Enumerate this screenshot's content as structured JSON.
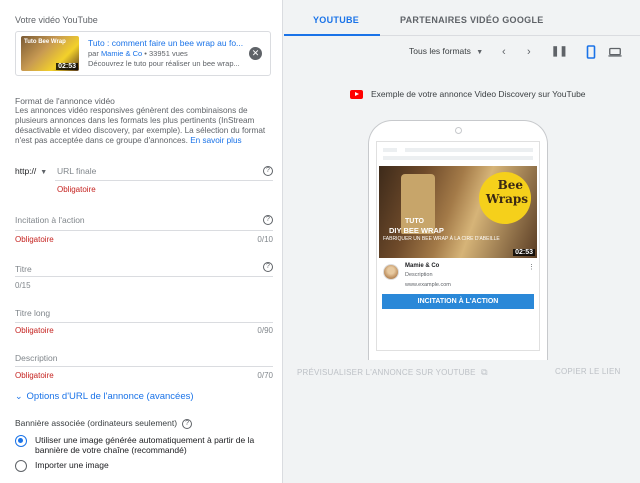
{
  "left": {
    "video_section_label": "Votre vidéo YouTube",
    "video": {
      "thumb_text": "Tuto Bee Wrap",
      "duration": "02:53",
      "title": "Tuto : comment faire un bee wrap au fo...",
      "by": "par",
      "channel": "Mamie & Co",
      "views": "• 33951 vues",
      "description": "Découvrez le tuto pour réaliser un bee wrap..."
    },
    "format": {
      "title": "Format de l'annonce vidéo",
      "text": "Les annonces vidéo responsives génèrent des combinaisons de plusieurs annonces dans les formats les plus pertinents (InStream désactivable et video discovery, par exemple). La sélection du format n'est pas acceptée dans ce groupe d'annonces.",
      "link": "En savoir plus"
    },
    "url_field": {
      "protocol": "http://",
      "placeholder": "URL finale",
      "error": "Obligatoire"
    },
    "cta_field": {
      "placeholder": "Incitation à l'action",
      "error": "Obligatoire",
      "counter": "0/10"
    },
    "title_field": {
      "placeholder": "Titre",
      "counter": "0/15"
    },
    "long_title_field": {
      "placeholder": "Titre long",
      "error": "Obligatoire",
      "counter": "0/90"
    },
    "description_field": {
      "placeholder": "Description",
      "error": "Obligatoire",
      "counter": "0/70"
    },
    "advanced_label": "Options d'URL de l'annonce (avancées)",
    "banner_label": "Bannière associée (ordinateurs seulement)",
    "radio_auto": "Utiliser une image générée automatiquement à partir de la bannière de votre chaîne (recommandé)",
    "radio_import": "Importer une image"
  },
  "right": {
    "tabs": [
      "YOUTUBE",
      "PARTENAIRES VIDÉO GOOGLE"
    ],
    "format_select": "Tous les formats",
    "example_label": "Exemple de votre annonce Video Discovery sur YouTube",
    "ad": {
      "brand_line1": "Bee",
      "brand_line2": "Wraps",
      "tuto": "TUTO",
      "headline": "DIY BEE WRAP",
      "subline": "FABRIQUER UN BEE WRAP À LA CIRE D'ABEILLE",
      "duration": "02:53",
      "channel": "Mamie & Co",
      "description": "Description",
      "url": "www.example.com",
      "cta": "INCITATION À L'ACTION"
    },
    "preview_link": "PRÉVISUALISER L'ANNONCE SUR YOUTUBE",
    "copy_link": "COPIER LE LIEN"
  },
  "colors": {
    "accent": "#1a73e8",
    "error": "#c5221f",
    "cta": "#2a88d8"
  }
}
